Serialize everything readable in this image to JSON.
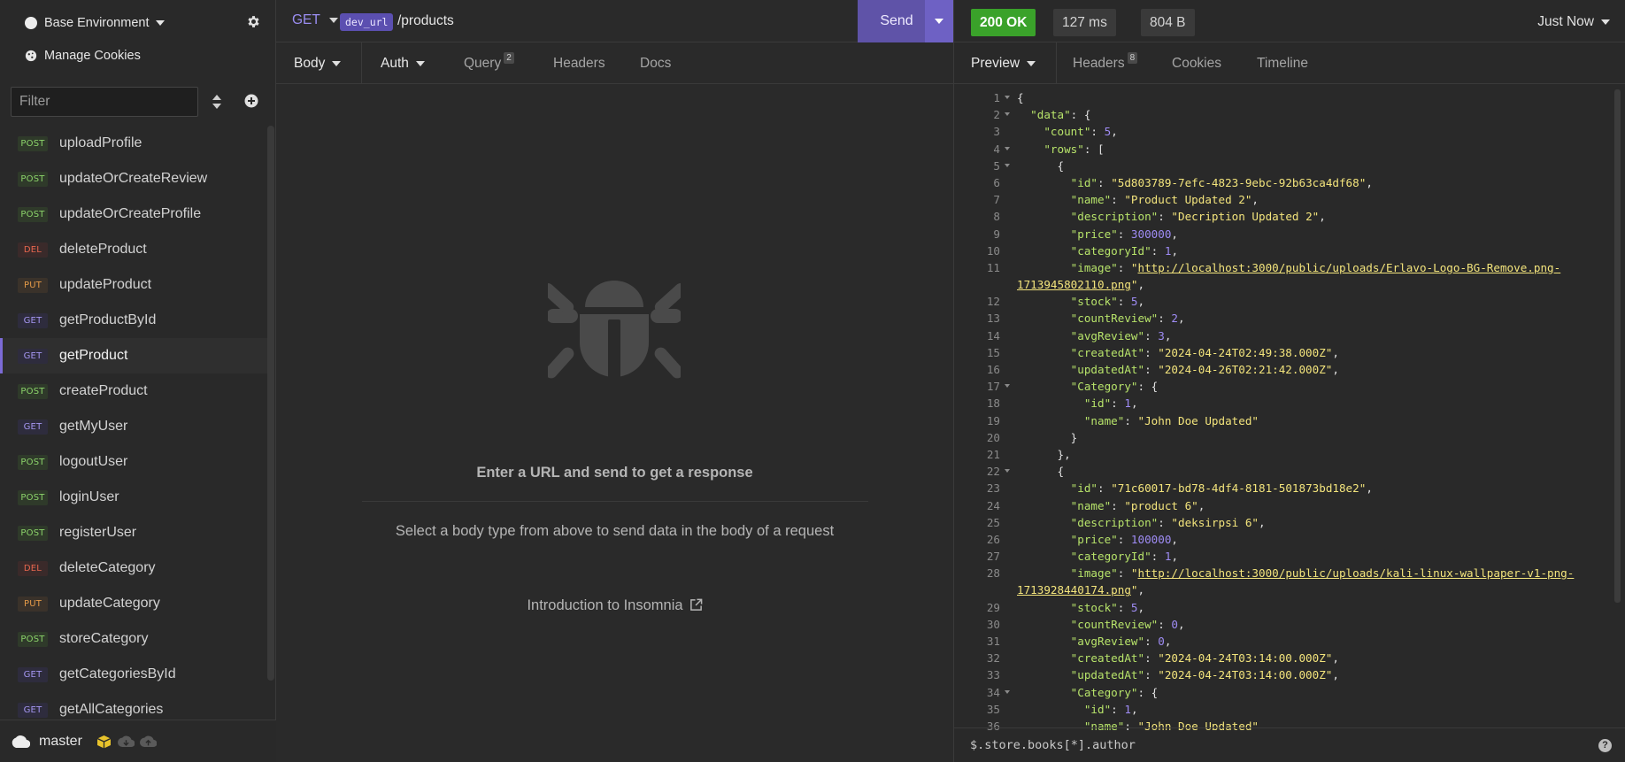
{
  "sidebar": {
    "environment": "Base Environment",
    "cookies": "Manage Cookies",
    "filter_placeholder": "Filter",
    "requests": [
      {
        "method": "POST",
        "name": "uploadProfile",
        "active": false
      },
      {
        "method": "POST",
        "name": "updateOrCreateReview",
        "active": false
      },
      {
        "method": "POST",
        "name": "updateOrCreateProfile",
        "active": false
      },
      {
        "method": "DEL",
        "name": "deleteProduct",
        "active": false
      },
      {
        "method": "PUT",
        "name": "updateProduct",
        "active": false
      },
      {
        "method": "GET",
        "name": "getProductById",
        "active": false
      },
      {
        "method": "GET",
        "name": "getProduct",
        "active": true
      },
      {
        "method": "POST",
        "name": "createProduct",
        "active": false
      },
      {
        "method": "GET",
        "name": "getMyUser",
        "active": false
      },
      {
        "method": "POST",
        "name": "logoutUser",
        "active": false
      },
      {
        "method": "POST",
        "name": "loginUser",
        "active": false
      },
      {
        "method": "POST",
        "name": "registerUser",
        "active": false
      },
      {
        "method": "DEL",
        "name": "deleteCategory",
        "active": false
      },
      {
        "method": "PUT",
        "name": "updateCategory",
        "active": false
      },
      {
        "method": "POST",
        "name": "storeCategory",
        "active": false
      },
      {
        "method": "GET",
        "name": "getCategoriesById",
        "active": false
      },
      {
        "method": "GET",
        "name": "getAllCategories",
        "active": false
      }
    ],
    "branch": "master"
  },
  "request": {
    "method": "GET",
    "env_var": "dev_url",
    "path": "/products",
    "send_label": "Send",
    "tabs": {
      "body": "Body",
      "auth": "Auth",
      "query": "Query",
      "query_count": "2",
      "headers": "Headers",
      "docs": "Docs"
    },
    "empty_title": "Enter a URL and send to get a response",
    "empty_sub": "Select a body type from above to send data in the body of a request",
    "intro_link": "Introduction to Insomnia"
  },
  "response": {
    "status": "200 OK",
    "time": "127 ms",
    "size": "804 B",
    "timestamp": "Just Now",
    "tabs": {
      "preview": "Preview",
      "headers": "Headers",
      "headers_count": "8",
      "cookies": "Cookies",
      "timeline": "Timeline"
    },
    "filter_query": "$.store.books[*].author",
    "lines": [
      {
        "n": "1",
        "fold": true,
        "parts": [
          [
            "p",
            "{"
          ]
        ]
      },
      {
        "n": "2",
        "fold": true,
        "parts": [
          [
            "p",
            "  "
          ],
          [
            "k",
            "\"data\""
          ],
          [
            "p",
            ": {"
          ]
        ]
      },
      {
        "n": "3",
        "fold": false,
        "parts": [
          [
            "p",
            "    "
          ],
          [
            "k",
            "\"count\""
          ],
          [
            "p",
            ": "
          ],
          [
            "n",
            "5"
          ],
          [
            "p",
            ","
          ]
        ]
      },
      {
        "n": "4",
        "fold": true,
        "parts": [
          [
            "p",
            "    "
          ],
          [
            "k",
            "\"rows\""
          ],
          [
            "p",
            ": ["
          ]
        ]
      },
      {
        "n": "5",
        "fold": true,
        "parts": [
          [
            "p",
            "      {"
          ]
        ]
      },
      {
        "n": "6",
        "fold": false,
        "parts": [
          [
            "p",
            "        "
          ],
          [
            "k",
            "\"id\""
          ],
          [
            "p",
            ": "
          ],
          [
            "s",
            "\"5d803789-7efc-4823-9ebc-92b63ca4df68\""
          ],
          [
            "p",
            ","
          ]
        ]
      },
      {
        "n": "7",
        "fold": false,
        "parts": [
          [
            "p",
            "        "
          ],
          [
            "k",
            "\"name\""
          ],
          [
            "p",
            ": "
          ],
          [
            "s",
            "\"Product Updated 2\""
          ],
          [
            "p",
            ","
          ]
        ]
      },
      {
        "n": "8",
        "fold": false,
        "parts": [
          [
            "p",
            "        "
          ],
          [
            "k",
            "\"description\""
          ],
          [
            "p",
            ": "
          ],
          [
            "s",
            "\"Decription Updated 2\""
          ],
          [
            "p",
            ","
          ]
        ]
      },
      {
        "n": "9",
        "fold": false,
        "parts": [
          [
            "p",
            "        "
          ],
          [
            "k",
            "\"price\""
          ],
          [
            "p",
            ": "
          ],
          [
            "n",
            "300000"
          ],
          [
            "p",
            ","
          ]
        ]
      },
      {
        "n": "10",
        "fold": false,
        "parts": [
          [
            "p",
            "        "
          ],
          [
            "k",
            "\"categoryId\""
          ],
          [
            "p",
            ": "
          ],
          [
            "n",
            "1"
          ],
          [
            "p",
            ","
          ]
        ]
      },
      {
        "n": "11",
        "fold": false,
        "parts": [
          [
            "p",
            "        "
          ],
          [
            "k",
            "\"image\""
          ],
          [
            "p",
            ": "
          ],
          [
            "s",
            "\""
          ],
          [
            "u",
            "http://localhost:3000/public/uploads/Erlavo-Logo-BG-Remove.png-"
          ]
        ]
      },
      {
        "n": "",
        "fold": false,
        "parts": [
          [
            "u",
            "1713945802110.png"
          ],
          [
            "s",
            "\""
          ],
          [
            "p",
            ","
          ]
        ]
      },
      {
        "n": "12",
        "fold": false,
        "parts": [
          [
            "p",
            "        "
          ],
          [
            "k",
            "\"stock\""
          ],
          [
            "p",
            ": "
          ],
          [
            "n",
            "5"
          ],
          [
            "p",
            ","
          ]
        ]
      },
      {
        "n": "13",
        "fold": false,
        "parts": [
          [
            "p",
            "        "
          ],
          [
            "k",
            "\"countReview\""
          ],
          [
            "p",
            ": "
          ],
          [
            "n",
            "2"
          ],
          [
            "p",
            ","
          ]
        ]
      },
      {
        "n": "14",
        "fold": false,
        "parts": [
          [
            "p",
            "        "
          ],
          [
            "k",
            "\"avgReview\""
          ],
          [
            "p",
            ": "
          ],
          [
            "n",
            "3"
          ],
          [
            "p",
            ","
          ]
        ]
      },
      {
        "n": "15",
        "fold": false,
        "parts": [
          [
            "p",
            "        "
          ],
          [
            "k",
            "\"createdAt\""
          ],
          [
            "p",
            ": "
          ],
          [
            "s",
            "\"2024-04-24T02:49:38.000Z\""
          ],
          [
            "p",
            ","
          ]
        ]
      },
      {
        "n": "16",
        "fold": false,
        "parts": [
          [
            "p",
            "        "
          ],
          [
            "k",
            "\"updatedAt\""
          ],
          [
            "p",
            ": "
          ],
          [
            "s",
            "\"2024-04-26T02:21:42.000Z\""
          ],
          [
            "p",
            ","
          ]
        ]
      },
      {
        "n": "17",
        "fold": true,
        "parts": [
          [
            "p",
            "        "
          ],
          [
            "k",
            "\"Category\""
          ],
          [
            "p",
            ": {"
          ]
        ]
      },
      {
        "n": "18",
        "fold": false,
        "parts": [
          [
            "p",
            "          "
          ],
          [
            "k",
            "\"id\""
          ],
          [
            "p",
            ": "
          ],
          [
            "n",
            "1"
          ],
          [
            "p",
            ","
          ]
        ]
      },
      {
        "n": "19",
        "fold": false,
        "parts": [
          [
            "p",
            "          "
          ],
          [
            "k",
            "\"name\""
          ],
          [
            "p",
            ": "
          ],
          [
            "s",
            "\"John Doe Updated\""
          ]
        ]
      },
      {
        "n": "20",
        "fold": false,
        "parts": [
          [
            "p",
            "        }"
          ]
        ]
      },
      {
        "n": "21",
        "fold": false,
        "parts": [
          [
            "p",
            "      },"
          ]
        ]
      },
      {
        "n": "22",
        "fold": true,
        "parts": [
          [
            "p",
            "      {"
          ]
        ]
      },
      {
        "n": "23",
        "fold": false,
        "parts": [
          [
            "p",
            "        "
          ],
          [
            "k",
            "\"id\""
          ],
          [
            "p",
            ": "
          ],
          [
            "s",
            "\"71c60017-bd78-4df4-8181-501873bd18e2\""
          ],
          [
            "p",
            ","
          ]
        ]
      },
      {
        "n": "24",
        "fold": false,
        "parts": [
          [
            "p",
            "        "
          ],
          [
            "k",
            "\"name\""
          ],
          [
            "p",
            ": "
          ],
          [
            "s",
            "\"product 6\""
          ],
          [
            "p",
            ","
          ]
        ]
      },
      {
        "n": "25",
        "fold": false,
        "parts": [
          [
            "p",
            "        "
          ],
          [
            "k",
            "\"description\""
          ],
          [
            "p",
            ": "
          ],
          [
            "s",
            "\"deksirpsi 6\""
          ],
          [
            "p",
            ","
          ]
        ]
      },
      {
        "n": "26",
        "fold": false,
        "parts": [
          [
            "p",
            "        "
          ],
          [
            "k",
            "\"price\""
          ],
          [
            "p",
            ": "
          ],
          [
            "n",
            "100000"
          ],
          [
            "p",
            ","
          ]
        ]
      },
      {
        "n": "27",
        "fold": false,
        "parts": [
          [
            "p",
            "        "
          ],
          [
            "k",
            "\"categoryId\""
          ],
          [
            "p",
            ": "
          ],
          [
            "n",
            "1"
          ],
          [
            "p",
            ","
          ]
        ]
      },
      {
        "n": "28",
        "fold": false,
        "parts": [
          [
            "p",
            "        "
          ],
          [
            "k",
            "\"image\""
          ],
          [
            "p",
            ": "
          ],
          [
            "s",
            "\""
          ],
          [
            "u",
            "http://localhost:3000/public/uploads/kali-linux-wallpaper-v1-png-"
          ]
        ]
      },
      {
        "n": "",
        "fold": false,
        "parts": [
          [
            "u",
            "1713928440174.png"
          ],
          [
            "s",
            "\""
          ],
          [
            "p",
            ","
          ]
        ]
      },
      {
        "n": "29",
        "fold": false,
        "parts": [
          [
            "p",
            "        "
          ],
          [
            "k",
            "\"stock\""
          ],
          [
            "p",
            ": "
          ],
          [
            "n",
            "5"
          ],
          [
            "p",
            ","
          ]
        ]
      },
      {
        "n": "30",
        "fold": false,
        "parts": [
          [
            "p",
            "        "
          ],
          [
            "k",
            "\"countReview\""
          ],
          [
            "p",
            ": "
          ],
          [
            "n",
            "0"
          ],
          [
            "p",
            ","
          ]
        ]
      },
      {
        "n": "31",
        "fold": false,
        "parts": [
          [
            "p",
            "        "
          ],
          [
            "k",
            "\"avgReview\""
          ],
          [
            "p",
            ": "
          ],
          [
            "n",
            "0"
          ],
          [
            "p",
            ","
          ]
        ]
      },
      {
        "n": "32",
        "fold": false,
        "parts": [
          [
            "p",
            "        "
          ],
          [
            "k",
            "\"createdAt\""
          ],
          [
            "p",
            ": "
          ],
          [
            "s",
            "\"2024-04-24T03:14:00.000Z\""
          ],
          [
            "p",
            ","
          ]
        ]
      },
      {
        "n": "33",
        "fold": false,
        "parts": [
          [
            "p",
            "        "
          ],
          [
            "k",
            "\"updatedAt\""
          ],
          [
            "p",
            ": "
          ],
          [
            "s",
            "\"2024-04-24T03:14:00.000Z\""
          ],
          [
            "p",
            ","
          ]
        ]
      },
      {
        "n": "34",
        "fold": true,
        "parts": [
          [
            "p",
            "        "
          ],
          [
            "k",
            "\"Category\""
          ],
          [
            "p",
            ": {"
          ]
        ]
      },
      {
        "n": "35",
        "fold": false,
        "parts": [
          [
            "p",
            "          "
          ],
          [
            "k",
            "\"id\""
          ],
          [
            "p",
            ": "
          ],
          [
            "n",
            "1"
          ],
          [
            "p",
            ","
          ]
        ]
      },
      {
        "n": "36",
        "fold": false,
        "parts": [
          [
            "p",
            "          "
          ],
          [
            "k",
            "\"name\""
          ],
          [
            "p",
            ": "
          ],
          [
            "s",
            "\"John Doe Updated\""
          ]
        ]
      }
    ]
  },
  "colors": {
    "accent": "#6e61c4",
    "ok": "#3aa22a",
    "json_key": "#b7e36a",
    "json_string": "#f3e47c",
    "json_number": "#9f8cf5"
  }
}
